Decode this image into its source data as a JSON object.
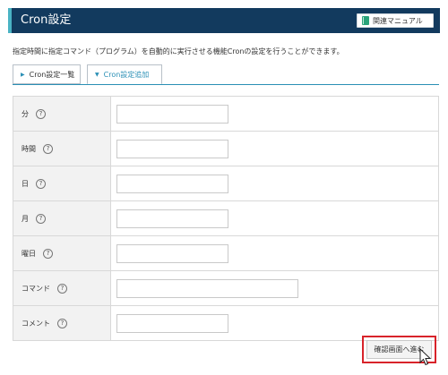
{
  "header": {
    "title": "Cron設定",
    "manual_label": "関連マニュアル",
    "manual_icon": "book-icon",
    "bg_color": "#123a5e",
    "accent_color": "#4ab3c4"
  },
  "description": "指定時間に指定コマンド（プログラム）を自動的に実行させる機能Cronの設定を行うことができます。",
  "tabs": [
    {
      "label": "Cron設定一覧",
      "icon": "triangle-right-icon",
      "active": false
    },
    {
      "label": "Cron設定追加",
      "icon": "triangle-down-icon",
      "active": true
    }
  ],
  "form": {
    "rows": [
      {
        "label": "分",
        "value": ""
      },
      {
        "label": "時間",
        "value": ""
      },
      {
        "label": "日",
        "value": ""
      },
      {
        "label": "月",
        "value": ""
      },
      {
        "label": "曜日",
        "value": ""
      },
      {
        "label": "コマンド",
        "value": ""
      },
      {
        "label": "コメント",
        "value": ""
      }
    ],
    "help_glyph": "?"
  },
  "confirm_button": "確認画面へ進む",
  "highlight_color": "#d8232a"
}
